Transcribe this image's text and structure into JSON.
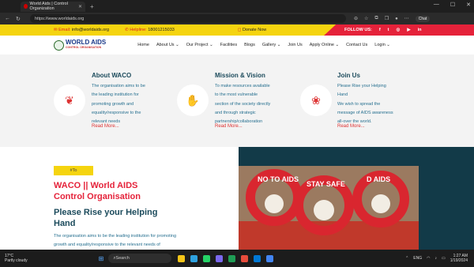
{
  "browser": {
    "tab_title": "World Aids | Control Organization",
    "url": "https://www.worldaids.org",
    "chat_label": "Chat"
  },
  "topbar": {
    "email_label": "Email:",
    "email_value": "info@worldaids.org",
    "helpline_label": "Helpline:",
    "helpline_value": "18001215033",
    "donate_label": "Donate Now",
    "follow_label": "FOLLOW US:"
  },
  "logo": {
    "line1": "WORLD AIDS",
    "line2": "CONTROL ORGANISATION"
  },
  "menu": [
    "Home",
    "About Us",
    "Our Project",
    "Facilities",
    "Blogs",
    "Gallery",
    "Join Us",
    "Apply Online",
    "Contact Us",
    "Login"
  ],
  "features": [
    {
      "title": "About WACO",
      "lines": [
        "The organisation aims to be",
        "the leading institution for",
        "promoting growth and",
        "equality/responsive to the",
        "relevant needs"
      ],
      "more": "Read More...",
      "icon": "praying-hands-icon"
    },
    {
      "title": "Mission & Vision",
      "lines": [
        "To make resources available",
        "to the most vulnerable",
        "section of the society directly",
        "and through strategic",
        "partnership/collaboration"
      ],
      "more": "Read More...",
      "icon": "helping-hands-icon"
    },
    {
      "title": "Join Us",
      "lines": [
        "Please Rise your Helping",
        "Hand",
        "We wish to spread the",
        "message of AIDS awareness",
        "all-over the world."
      ],
      "more": "Read More...",
      "icon": "sprout-icon"
    }
  ],
  "hero": {
    "tag": "#To",
    "title_lines": [
      "WACO || World AIDS",
      "Control Organisation"
    ],
    "subtitle_lines": [
      "Please Rise your Helping",
      "Hand"
    ],
    "desc_lines": [
      "The organisation aims to be the leading institution for promoting",
      "growth and equality/responsive to the relevant needs of"
    ],
    "photo_texts": [
      "NO TO AIDS",
      "STAY SAFE",
      "D AIDS"
    ]
  },
  "taskbar": {
    "temp": "17°C",
    "weather": "Partly cloudy",
    "search_placeholder": "Search",
    "lang": "ENG",
    "time": "1:27 AM",
    "date": "1/19/2024"
  },
  "colors": {
    "yellow": "#f5d40f",
    "red": "#e5223a",
    "teal": "#1c4b5c"
  }
}
